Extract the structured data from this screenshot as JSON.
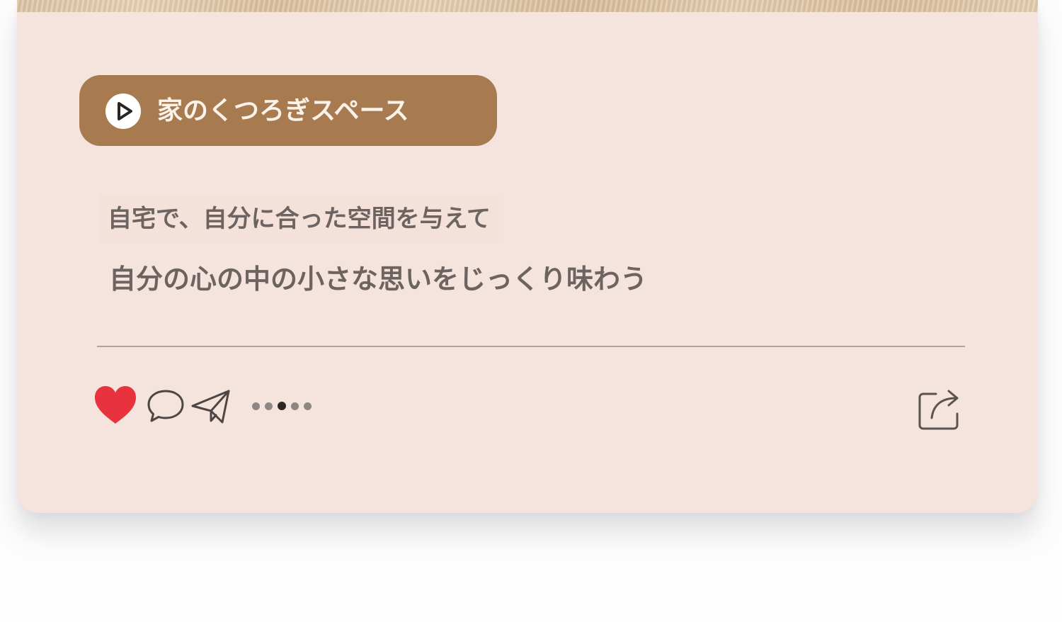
{
  "post": {
    "tag_label": "家のくつろぎスペース",
    "caption_line_1": "自宅で、自分に合った空間を与えて",
    "caption_line_2": "自分の心の中の小さな思いをじっくり味わう"
  },
  "actions": {
    "like_icon": "heart-icon",
    "like_color": "#e8333e",
    "comment_icon": "comment-icon",
    "send_icon": "paper-plane-icon",
    "share_icon": "share-icon"
  },
  "carousel": {
    "total": 5,
    "active_index": 2
  },
  "colors": {
    "card_background": "#f5e3dd",
    "tag_background": "#a87a4f",
    "text": "#6d6462"
  }
}
